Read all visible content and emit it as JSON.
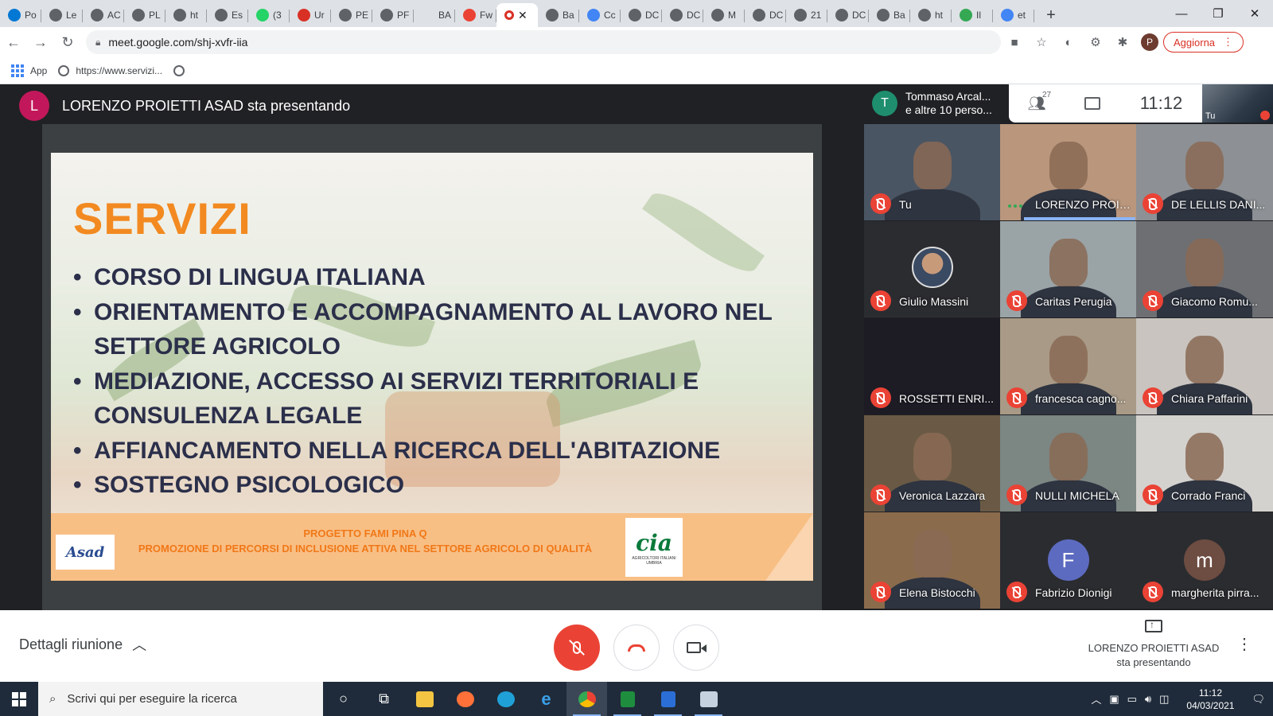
{
  "browser": {
    "tabs": [
      {
        "label": "Po",
        "favicon": "outlook-icon",
        "color": "#0078d4"
      },
      {
        "label": "Le",
        "favicon": "globe-icon",
        "color": "#5f6368"
      },
      {
        "label": "AC",
        "favicon": "globe-icon",
        "color": "#5f6368"
      },
      {
        "label": "PL",
        "favicon": "globe-icon",
        "color": "#5f6368"
      },
      {
        "label": "ht",
        "favicon": "globe-icon",
        "color": "#5f6368"
      },
      {
        "label": "Es",
        "favicon": "globe-icon",
        "color": "#5f6368"
      },
      {
        "label": "(3",
        "favicon": "whatsapp-icon",
        "color": "#25d366"
      },
      {
        "label": "Ur",
        "favicon": "p-icon",
        "color": "#d93025"
      },
      {
        "label": "PE",
        "favicon": "globe-icon",
        "color": "#5f6368"
      },
      {
        "label": "PF",
        "favicon": "globe-icon",
        "color": "#5f6368"
      },
      {
        "label": "BA",
        "favicon": "blank-icon",
        "color": "#dee1e6"
      },
      {
        "label": "Fw",
        "favicon": "gmail-icon",
        "color": "#ea4335"
      },
      {
        "label": "",
        "favicon": "recording-icon",
        "color": "#d93025",
        "active": true
      },
      {
        "label": "Ba",
        "favicon": "globe-icon",
        "color": "#5f6368"
      },
      {
        "label": "Cc",
        "favicon": "docs-icon",
        "color": "#4285f4"
      },
      {
        "label": "DC",
        "favicon": "globe-icon",
        "color": "#5f6368"
      },
      {
        "label": "DC",
        "favicon": "globe-icon",
        "color": "#5f6368"
      },
      {
        "label": "M",
        "favicon": "globe-icon",
        "color": "#5f6368"
      },
      {
        "label": "DC",
        "favicon": "globe-icon",
        "color": "#5f6368"
      },
      {
        "label": "21",
        "favicon": "globe-icon",
        "color": "#5f6368"
      },
      {
        "label": "DC",
        "favicon": "globe-icon",
        "color": "#5f6368"
      },
      {
        "label": "Ba",
        "favicon": "globe-icon",
        "color": "#5f6368"
      },
      {
        "label": "ht",
        "favicon": "globe-icon",
        "color": "#5f6368"
      },
      {
        "label": "Il",
        "favicon": "ext-icon",
        "color": "#34a853"
      },
      {
        "label": "et",
        "favicon": "google-icon",
        "color": "#4285f4"
      }
    ],
    "url": "meet.google.com/shj-xvfr-iia",
    "update_label": "Aggiorna",
    "profile_initial": "P",
    "bookmarks": [
      {
        "label": "App"
      },
      {
        "label": "https://www.servizi..."
      }
    ]
  },
  "meet": {
    "presenter": {
      "initial": "L",
      "text": "LORENZO PROIETTI ASAD sta presentando"
    },
    "slide": {
      "title": "SERVIZI",
      "bullets": [
        "CORSO DI LINGUA ITALIANA",
        "ORIENTAMENTO  E ACCOMPAGNAMENTO AL LAVORO NEL SETTORE AGRICOLO",
        "MEDIAZIONE, ACCESSO AI SERVIZI TERRITORIALI E CONSULENZA LEGALE",
        "AFFIANCAMENTO NELLA RICERCA DELL'ABITAZIONE",
        "SOSTEGNO PSICOLOGICO"
      ],
      "footer_line1": "PROGETTO FAMI PINA Q",
      "footer_line2": "PROMOZIONE DI PERCORSI DI INCLUSIONE ATTIVA NEL SETTORE AGRICOLO DI QUALITÀ",
      "logo_left": "Asad",
      "logo_right": "cia",
      "logo_right_sub": "AGRICOLTORI ITALIANI UMBRIA"
    },
    "participant_summary": {
      "initial": "T",
      "line1": "Tommaso Arcal...",
      "line2": "e altre 10 perso..."
    },
    "people_count": "27",
    "clock": "11:12",
    "self_label": "Tu",
    "tiles": [
      {
        "name": "Tu",
        "state": "muted",
        "bg": "#4a5563"
      },
      {
        "name": "LORENZO PROIE...",
        "state": "speaking",
        "bg": "#b9967c"
      },
      {
        "name": "DE LELLIS DANI...",
        "state": "muted",
        "bg": "#8d9094"
      },
      {
        "name": "Giulio Massini",
        "state": "muted",
        "bg": "#2b2c30",
        "avatar": "photo"
      },
      {
        "name": "Caritas Perugia",
        "state": "muted",
        "bg": "#9aa3a6"
      },
      {
        "name": "Giacomo Romu...",
        "state": "muted",
        "bg": "#6d6f73"
      },
      {
        "name": "ROSSETTI ENRI...",
        "state": "muted",
        "bg": "#1d1b24"
      },
      {
        "name": "francesca cagno...",
        "state": "muted",
        "bg": "#a89a86"
      },
      {
        "name": "Chiara Paffarini",
        "state": "muted",
        "bg": "#c9c4bf"
      },
      {
        "name": "Veronica Lazzara",
        "state": "muted",
        "bg": "#6a5a45"
      },
      {
        "name": "NULLI MICHELA",
        "state": "muted",
        "bg": "#7c8683"
      },
      {
        "name": "Corrado Franci",
        "state": "muted",
        "bg": "#d4d2ce"
      },
      {
        "name": "Elena Bistocchi",
        "state": "muted",
        "bg": "#8a6b4c"
      },
      {
        "name": "Fabrizio Dionigi",
        "state": "muted",
        "bg": "#2b2c30",
        "avatar": "initial",
        "initial": "F",
        "avatar_color": "#5c6bc0"
      },
      {
        "name": "margherita pirra...",
        "state": "muted",
        "bg": "#2b2c30",
        "avatar": "initial",
        "initial": "m",
        "avatar_color": "#6d4c41"
      }
    ],
    "bottom": {
      "details_label": "Dettagli riunione",
      "presenting_name": "LORENZO PROIETTI ASAD",
      "presenting_status": "sta presentando"
    }
  },
  "taskbar": {
    "search_placeholder": "Scrivi qui per eseguire la ricerca",
    "time": "11:12",
    "date": "04/03/2021"
  }
}
